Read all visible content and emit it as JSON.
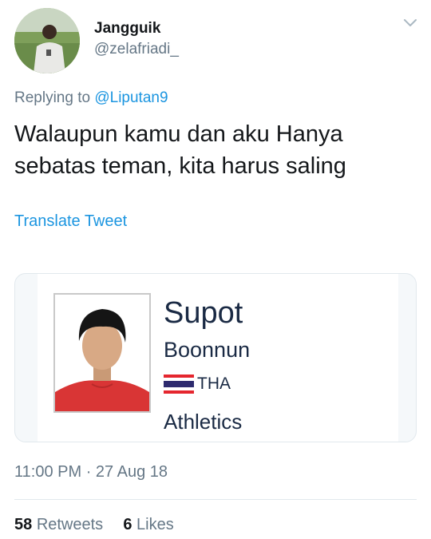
{
  "author": {
    "display_name": "Jangguik",
    "handle": "@zelafriadi_",
    "avatar_icon": "profile-photo"
  },
  "reply": {
    "prefix": "Replying to",
    "mention": "@Liputan9"
  },
  "tweet": {
    "lines": [
      "Walaupun kamu dan aku Hanya",
      "sebatas teman, kita harus saling"
    ],
    "translate_label": "Translate Tweet"
  },
  "card": {
    "first_name": "Supot",
    "last_name": "Boonnun",
    "country_code": "THA",
    "flag_icon": "thailand-flag-icon",
    "sport": "Athletics"
  },
  "meta": {
    "time": "11:00 PM",
    "separator": "·",
    "date": "27 Aug 18"
  },
  "stats": {
    "retweets_count": "58",
    "retweets_label": "Retweets",
    "likes_count": "6",
    "likes_label": "Likes"
  },
  "colors": {
    "link": "#1b95e0",
    "secondary_text": "#657786",
    "primary_text": "#14171a"
  }
}
